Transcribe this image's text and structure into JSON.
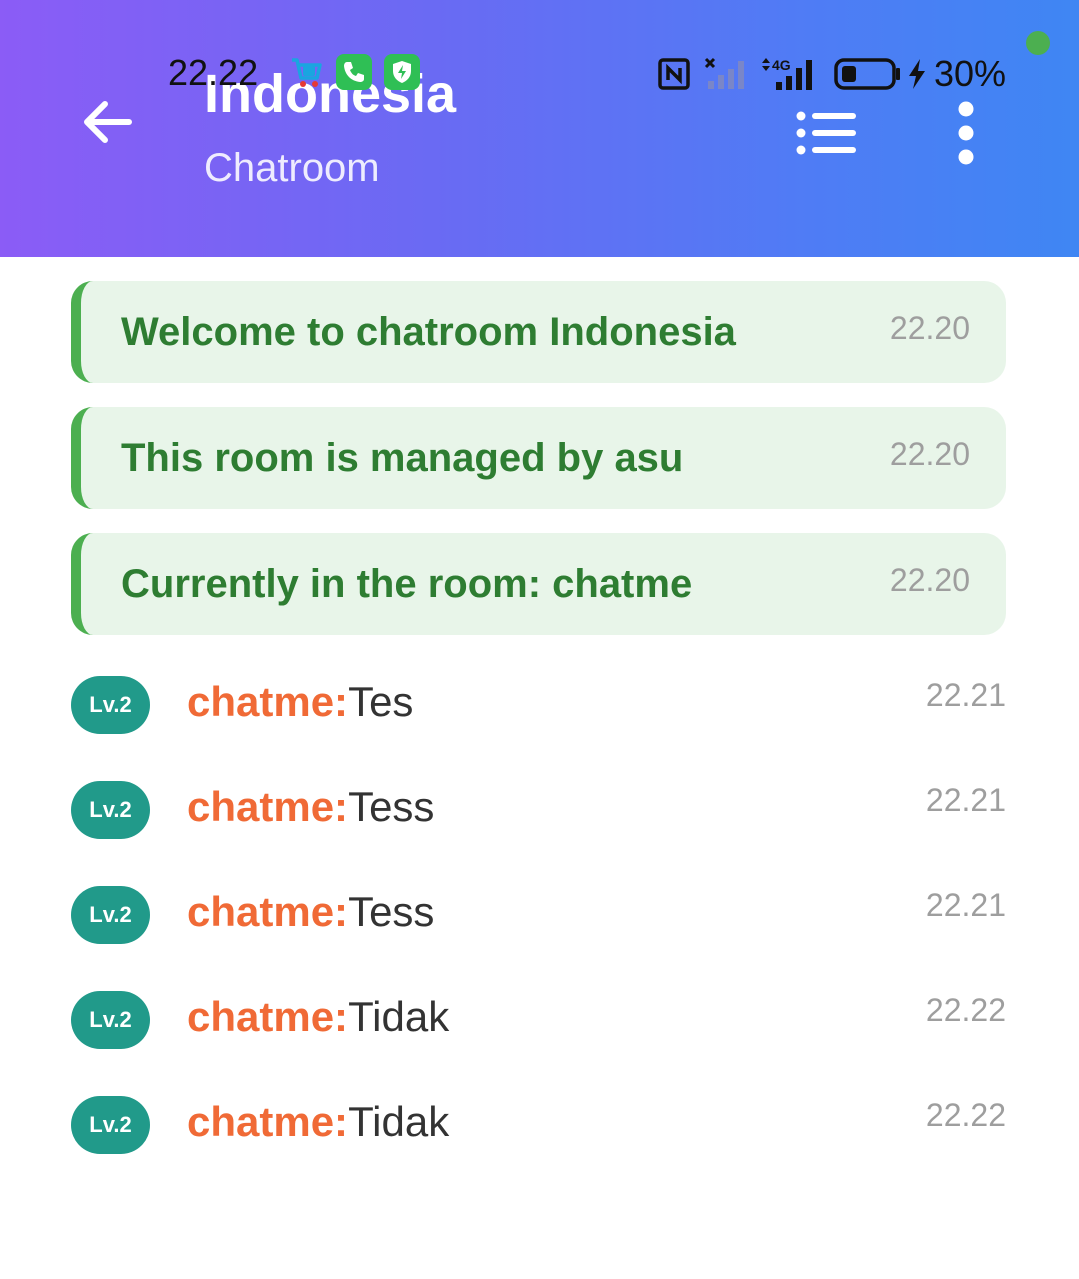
{
  "status_bar": {
    "time": "22.22",
    "battery_percent": "30%",
    "network_label": "4G",
    "icons": [
      "shop-icon",
      "phone-icon",
      "shield-icon",
      "nfc-icon",
      "no-signal-icon",
      "signal-4g-icon",
      "battery-icon",
      "charging-icon",
      "camera-indicator-dot"
    ]
  },
  "header": {
    "title": "Indonesia",
    "subtitle": "Chatroom",
    "back_icon": "arrow-left-icon",
    "list_icon": "list-icon",
    "more_icon": "more-vertical-icon"
  },
  "colors": {
    "header_gradient_start": "#8b5cf6",
    "header_gradient_end": "#3f86f3",
    "system_bg": "#e8f5e9",
    "system_border": "#4caf50",
    "system_text": "#2e7d32",
    "sender": "#f06a36",
    "badge": "#219a8a",
    "timestamp": "#9e9e9e"
  },
  "system_messages": [
    {
      "text": "Welcome to chatroom Indonesia",
      "time": "22.20"
    },
    {
      "text": "This room is managed by asu",
      "time": "22.20"
    },
    {
      "text": "Currently in the room: chatme",
      "time": "22.20"
    }
  ],
  "chat_messages": [
    {
      "level": "Lv.2",
      "sender": "chatme:",
      "text": "Tes",
      "time": "22.21"
    },
    {
      "level": "Lv.2",
      "sender": "chatme:",
      "text": "Tess",
      "time": "22.21"
    },
    {
      "level": "Lv.2",
      "sender": "chatme:",
      "text": "Tess",
      "time": "22.21"
    },
    {
      "level": "Lv.2",
      "sender": "chatme:",
      "text": "Tidak",
      "time": "22.22"
    },
    {
      "level": "Lv.2",
      "sender": "chatme:",
      "text": "Tidak",
      "time": "22.22"
    }
  ]
}
